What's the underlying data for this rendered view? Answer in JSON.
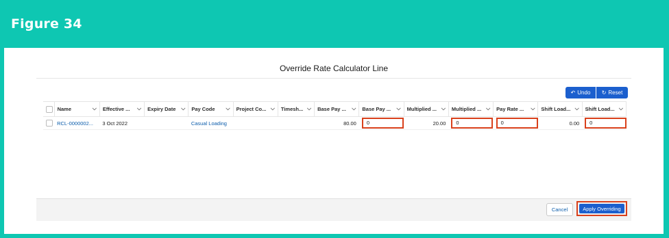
{
  "figure_label": "Figure 34",
  "modal": {
    "title": "Override Rate Calculator Line",
    "undo_label": "Undo",
    "reset_label": "Reset",
    "cancel_label": "Cancel",
    "apply_label": "Apply Overriding"
  },
  "table": {
    "columns": [
      "Name",
      "Effective ...",
      "Expiry Date",
      "Pay Code",
      "Project Co...",
      "Timesh...",
      "Base Pay ...",
      "Base Pay ...",
      "Multiplied ...",
      "Multiplied ...",
      "Pay Rate ...",
      "Shift Load...",
      "Shift Load..."
    ],
    "row": {
      "name": "RCL-0000002...",
      "effective_date": "3 Oct 2022",
      "expiry_date": "",
      "pay_code": "Casual Loading",
      "project_code": "",
      "timesheet": "",
      "base_pay": "80.00",
      "base_pay_override": "0",
      "multiplied": "20.00",
      "multiplied_override": "0",
      "pay_rate_override": "0",
      "shift_loading": "0.00",
      "shift_loading_override": "0"
    }
  },
  "colors": {
    "banner": "#0ec7b2",
    "brand_button": "#1b5fce",
    "highlight": "#d9401b",
    "link": "#0b5cab"
  },
  "icons": {
    "undo": "undo-icon",
    "reset": "refresh-icon",
    "column_menu": "chevron-down-icon"
  }
}
